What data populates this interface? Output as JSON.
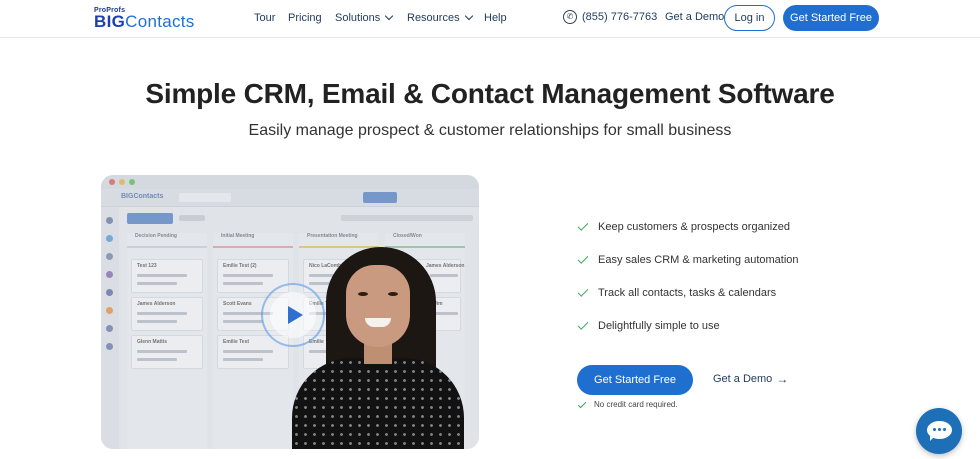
{
  "nav": {
    "logo_small": "ProProfs",
    "logo_big_1": "BIG",
    "logo_big_2": "Contacts",
    "items": [
      {
        "label": "Tour"
      },
      {
        "label": "Pricing"
      },
      {
        "label": "Solutions"
      },
      {
        "label": "Resources"
      },
      {
        "label": "Help"
      }
    ],
    "phone": "(855) 776-7763",
    "demo_label": "Get a Demo",
    "login_label": "Log in",
    "start_label": "Get Started Free"
  },
  "hero": {
    "title": "Simple CRM, Email & Contact Management Software",
    "subtitle": "Easily manage prospect & customer relationships for small business"
  },
  "video": {
    "app_logo": "BIGContacts",
    "columns": [
      {
        "name": "Decision Pending",
        "cards": [
          "Test 123",
          "James Alderson",
          "Glenn Mattis"
        ]
      },
      {
        "name": "Initial Meeting",
        "cards": [
          "Emilie Test (2)",
          "Scott Evans",
          "Emilie Test"
        ]
      },
      {
        "name": "Presentation Meeting",
        "cards": [
          "Nico LaComb",
          "Emilie Te",
          "Emilie"
        ]
      },
      {
        "name": "Closed/Won",
        "cards": [
          "James Alderson",
          "Jim"
        ]
      }
    ]
  },
  "features": [
    {
      "text": "Keep customers & prospects organized"
    },
    {
      "text": "Easy sales CRM & marketing automation"
    },
    {
      "text": "Track all contacts, tasks & calendars"
    },
    {
      "text": "Delightfully simple to use"
    }
  ],
  "cta": {
    "start_label": "Get Started Free",
    "demo_label": "Get a Demo",
    "note": "No credit card required."
  },
  "colors": {
    "primary": "#1f6fd1",
    "check": "#3aa757",
    "chat": "#1d6fb8"
  },
  "icons": {
    "phone": "phone-icon",
    "arrow": "arrow-right-icon",
    "chat": "chat-icon",
    "play": "play-icon"
  }
}
